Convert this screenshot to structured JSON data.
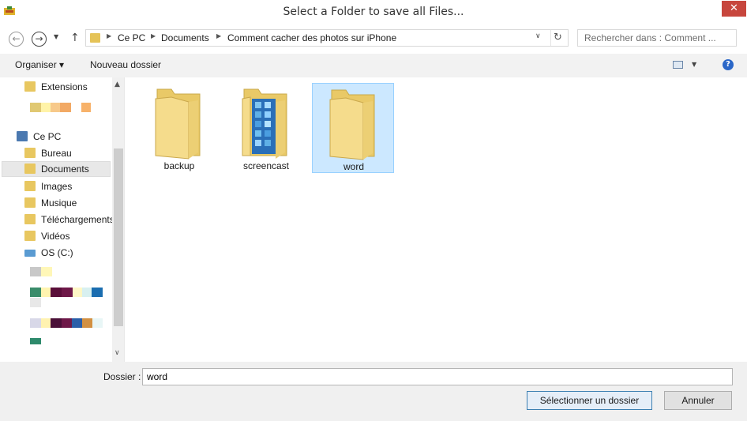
{
  "window": {
    "title": "Select a Folder to save all Files...",
    "close_glyph": "✕"
  },
  "nav": {
    "back_icon": "arrow-left-icon",
    "forward_icon": "arrow-right-icon",
    "up_icon": "arrow-up-icon",
    "back_glyph": "←",
    "forward_glyph": "→",
    "recent_glyph": "▼",
    "up_glyph": "↑",
    "address": [
      "Ce PC",
      "Documents",
      "Comment cacher des photos sur iPhone"
    ],
    "dropdown_glyph": "∨",
    "refresh_glyph": "↻",
    "search_placeholder": "Rechercher dans : Comment ..."
  },
  "toolbar": {
    "organize": "Organiser",
    "organize_arrow": "▾",
    "new_folder": "Nouveau dossier",
    "view_dropdown_glyph": "▼",
    "help_glyph": "?"
  },
  "sidebar": {
    "items": [
      {
        "label": "Extensions",
        "icon": "folder-icon"
      },
      {
        "label": "Ce PC",
        "icon": "computer-icon"
      },
      {
        "label": "Bureau",
        "icon": "desktop-folder-icon"
      },
      {
        "label": "Documents",
        "icon": "documents-folder-icon",
        "selected": true
      },
      {
        "label": "Images",
        "icon": "pictures-folder-icon"
      },
      {
        "label": "Musique",
        "icon": "music-folder-icon"
      },
      {
        "label": "Téléchargements",
        "icon": "downloads-folder-icon"
      },
      {
        "label": "Vidéos",
        "icon": "videos-folder-icon"
      },
      {
        "label": "OS (C:)",
        "icon": "drive-icon"
      }
    ],
    "scroll_up_glyph": "▲",
    "scroll_down_glyph": "∨",
    "blurred_colors": [
      "#e0c872",
      "#fff3a8",
      "#f7c98a",
      "#f2a964",
      "#f7b26a",
      "#c8c8c8",
      "#fff7b8",
      "#3a8c6a",
      "#fff4b0",
      "#5a0f3a",
      "#6e1848",
      "#fff7c6",
      "#d8f0f0",
      "#1a6db0",
      "#e8e8e8",
      "#d8d8e8",
      "#fff2b0",
      "#4a1038",
      "#6e1848",
      "#2a5ea8",
      "#d29042",
      "#e8f6f6",
      "#2e8a6c"
    ]
  },
  "files": [
    {
      "name": "backup",
      "icon": "folder-icon"
    },
    {
      "name": "screencast",
      "icon": "folder-with-screenshots-icon"
    },
    {
      "name": "word",
      "icon": "folder-icon",
      "selected": true
    }
  ],
  "footer": {
    "folder_label": "Dossier :",
    "folder_value": "word",
    "select_button": "Sélectionner un dossier",
    "cancel_button": "Annuler"
  }
}
